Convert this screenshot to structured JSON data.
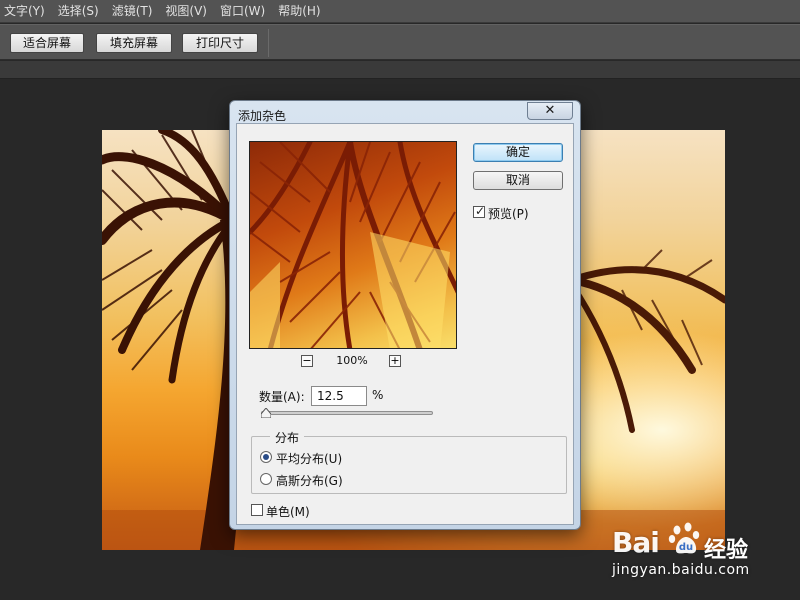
{
  "menubar": {
    "items": [
      "文字(Y)",
      "选择(S)",
      "滤镜(T)",
      "视图(V)",
      "窗口(W)",
      "帮助(H)"
    ]
  },
  "optionsbar": {
    "fit_screen": "适合屏幕",
    "fill_screen": "填充屏幕",
    "print_size": "打印尺寸"
  },
  "dialog": {
    "title": "添加杂色",
    "close_glyph": "✕",
    "ok_label": "确定",
    "cancel_label": "取消",
    "preview": {
      "label": "预览(P)",
      "checked": true
    },
    "zoom": {
      "minus": "−",
      "plus": "+",
      "level": "100%"
    },
    "amount": {
      "label": "数量(A):",
      "value": "12.5",
      "unit": "%",
      "slider_fraction": 0.03
    },
    "distribution": {
      "legend": "分布",
      "options": [
        {
          "label": "平均分布(U)",
          "selected": true
        },
        {
          "label": "高斯分布(G)",
          "selected": false
        }
      ]
    },
    "monochrome": {
      "label": "单色(M)",
      "checked": false
    }
  },
  "watermark": {
    "logo": "Bai",
    "logo_suffix": "经验",
    "url": "jingyan.baidu.com"
  },
  "colors": {
    "app_bg": "#282828",
    "panel": "#535353",
    "dialog_face": "#f0f0f0",
    "ok_accent": "#3c7fb1"
  }
}
